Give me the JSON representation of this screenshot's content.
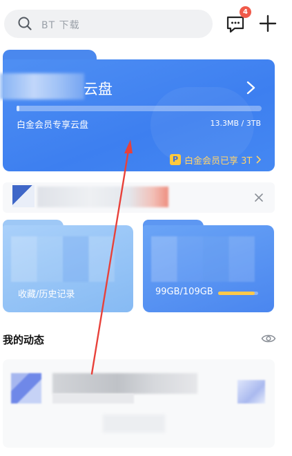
{
  "search": {
    "placeholder": "BT 下载"
  },
  "header": {
    "message_badge": "4"
  },
  "cloud": {
    "title": "云盘",
    "subtitle": "白金会员专享云盘",
    "usage": "13.3MB / 3TB",
    "usage_fraction": 0.01,
    "vip_icon": "P",
    "vip_text": "白金会员已享 3T"
  },
  "notice": {
    "text": ""
  },
  "tiles": {
    "left_label": "收藏/历史记录",
    "right_storage": "99GB/109GB",
    "right_fraction": 0.91
  },
  "feed": {
    "section_title": "我的动态"
  },
  "colors": {
    "accent": "#3d7ff0",
    "badge": "#f05a4a",
    "vip_gold": "#ffd36b",
    "annotation_arrow": "#e8413a"
  }
}
